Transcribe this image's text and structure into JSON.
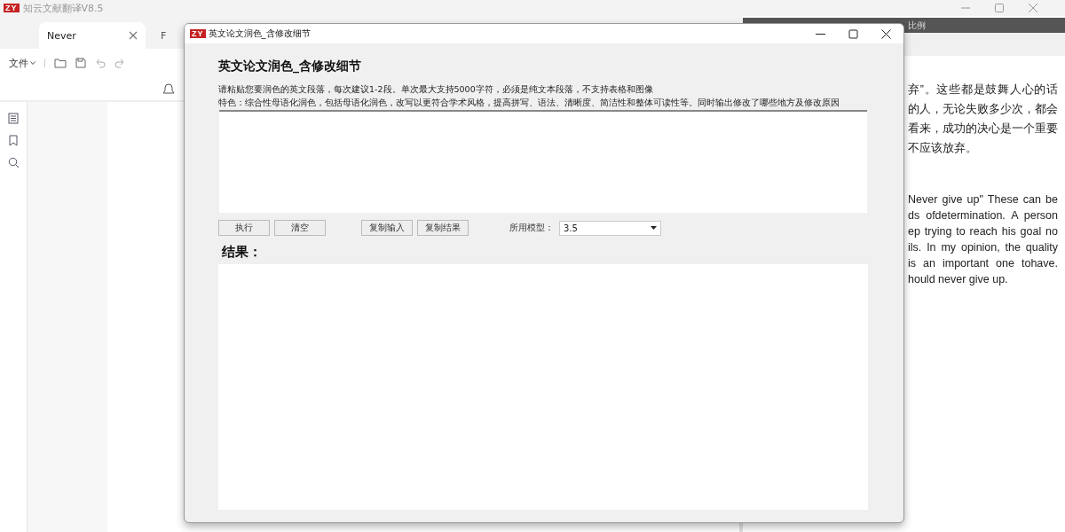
{
  "app": {
    "logo": "ZY",
    "title": "知云文献翻译V8.5"
  },
  "tabs": [
    {
      "label": "Never",
      "selected": true
    },
    {
      "label": "F",
      "selected": false
    }
  ],
  "toolbar": {
    "file_menu": "文件"
  },
  "side_panel": {
    "header": "比例",
    "zh_lines": [
      "弃”。这些都是鼓舞人心的话",
      "的人，无论失败多少次，都会",
      "看来，成功的决心是一个重要",
      "不应该放弃。"
    ],
    "en_lines": [
      "Never give up\" These can be",
      "ds ofdetermination. A person",
      "ep trying to reach his goal no",
      "ils. In my opinion, the quality",
      "is an important one tohave.",
      "hould never give up."
    ]
  },
  "dialog": {
    "logo": "ZY",
    "title": "英文论文润色_含修改细节",
    "heading": "英文论文润色_含修改细节",
    "instructions": [
      "请粘贴您要润色的英文段落，每次建议1-2段。单次最大支持5000字符，必须是纯文本段落，不支持表格和图像",
      "特色：综合性母语化润色，包括母语化润色，改写以更符合学术风格，提高拼写、语法、清晰度、简洁性和整体可读性等。同时输出修改了哪些地方及修改原因"
    ],
    "button_groups": [
      [
        "执行",
        "清空"
      ],
      [
        "复制输入",
        "复制结果"
      ]
    ],
    "model": {
      "label": "所用模型：",
      "value": "3.5"
    },
    "result_label": "结果："
  }
}
